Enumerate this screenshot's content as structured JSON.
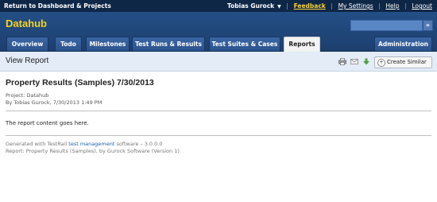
{
  "topbar": {
    "back_label": "Return to Dashboard & Projects",
    "user_name": "Tobias Gurock",
    "links": [
      "Feedback",
      "My Settings",
      "Help",
      "Logout"
    ]
  },
  "header": {
    "project_name": "Datahub",
    "search": {
      "placeholder": "",
      "go_label": "»"
    },
    "tabs": [
      {
        "label": "Overview"
      },
      {
        "label": "Todo"
      },
      {
        "label": "Milestones"
      },
      {
        "label": "Test Runs & Results"
      },
      {
        "label": "Test Suites & Cases"
      },
      {
        "label": "Reports"
      },
      {
        "label": "Administration"
      }
    ],
    "active_tab": "Reports"
  },
  "subheader": {
    "title": "View Report",
    "icons": [
      "print-icon",
      "email-icon",
      "download-icon"
    ],
    "create_button": "Create Similar"
  },
  "report": {
    "title": "Property Results (Samples) 7/30/2013",
    "project_line": "Project: Datahub",
    "by_line": "By Tobias Gurock, 7/30/2013 1:49 PM",
    "content": "The report content goes here."
  },
  "footer": {
    "generated_prefix": "Generated with TestRail",
    "generated_link": "test management",
    "generated_suffix": "software – 3.0.0.0",
    "report_line": "Report: Property Results (Samples), by Gurock Software (Version 1)"
  },
  "colors": {
    "topbar_bg": "#0f2747",
    "header_bg": "#234f86",
    "project_name": "#f6d21b",
    "feedback_link": "#f5d23a",
    "subheader_bg": "#e3ecf7",
    "link": "#1f5fa8"
  }
}
